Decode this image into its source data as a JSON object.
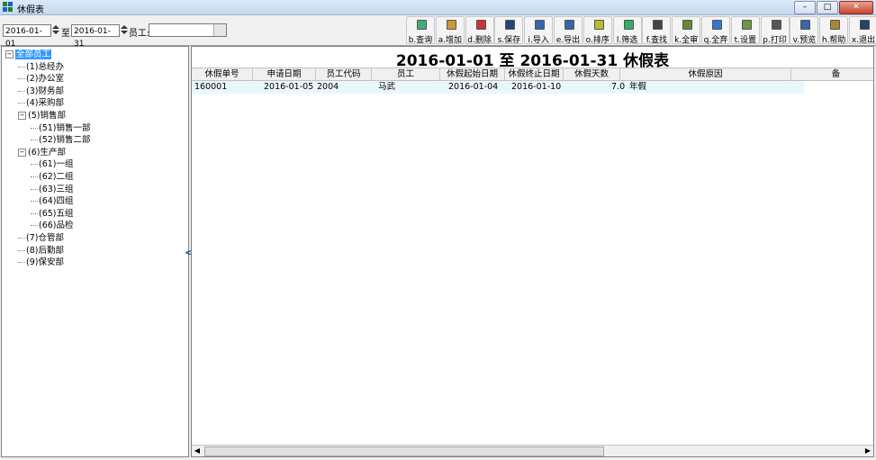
{
  "window": {
    "title": "休假表",
    "min": "–",
    "max": "□",
    "close": "✕"
  },
  "filter": {
    "date_from": "2016-01-01",
    "to_label": "至",
    "date_to": "2016-01-31",
    "employee_label": "员工:",
    "employee_value": ""
  },
  "toolbar": [
    {
      "key": "b",
      "label": "b.查询",
      "icon": "query-icon"
    },
    {
      "key": "a",
      "label": "a.增加",
      "icon": "add-icon"
    },
    {
      "key": "d",
      "label": "d.删除",
      "icon": "delete-icon"
    },
    {
      "key": "s",
      "label": "s.保存",
      "icon": "save-icon"
    },
    {
      "key": "i",
      "label": "i.导入",
      "icon": "import-icon"
    },
    {
      "key": "e",
      "label": "e.导出",
      "icon": "export-icon"
    },
    {
      "key": "o",
      "label": "o.排序",
      "icon": "sort-icon"
    },
    {
      "key": "l",
      "label": "l.筛选",
      "icon": "filter-icon"
    },
    {
      "key": "f",
      "label": "f.查找",
      "icon": "find-icon"
    },
    {
      "key": "k",
      "label": "k.全审",
      "icon": "approve-all-icon"
    },
    {
      "key": "q",
      "label": "q.全弃",
      "icon": "discard-all-icon"
    },
    {
      "key": "t",
      "label": "t.设置",
      "icon": "settings-icon"
    },
    {
      "key": "p",
      "label": "p.打印",
      "icon": "print-icon"
    },
    {
      "key": "v",
      "label": "v.预览",
      "icon": "preview-icon"
    },
    {
      "key": "h",
      "label": "h.帮助",
      "icon": "help-icon"
    },
    {
      "key": "x",
      "label": "x.退出",
      "icon": "exit-icon"
    }
  ],
  "tree": [
    {
      "label": "全部员工",
      "level": 0,
      "box": "−",
      "selected": true
    },
    {
      "label": "(1)总经办",
      "level": 1
    },
    {
      "label": "(2)办公室",
      "level": 1
    },
    {
      "label": "(3)财务部",
      "level": 1
    },
    {
      "label": "(4)采购部",
      "level": 1
    },
    {
      "label": "(5)销售部",
      "level": 1,
      "box": "−"
    },
    {
      "label": "(51)销售一部",
      "level": 2
    },
    {
      "label": "(52)销售二部",
      "level": 2
    },
    {
      "label": "(6)生产部",
      "level": 1,
      "box": "−"
    },
    {
      "label": "(61)一组",
      "level": 2
    },
    {
      "label": "(62)二组",
      "level": 2
    },
    {
      "label": "(63)三组",
      "level": 2
    },
    {
      "label": "(64)四组",
      "level": 2
    },
    {
      "label": "(65)五组",
      "level": 2
    },
    {
      "label": "(66)品检",
      "level": 2
    },
    {
      "label": "(7)仓管部",
      "level": 1
    },
    {
      "label": "(8)后勤部",
      "level": 1
    },
    {
      "label": "(9)保安部",
      "level": 1
    }
  ],
  "collapse_glyph": "<<",
  "report": {
    "title": "2016-01-01 至 2016-01-31 休假表",
    "columns": [
      "休假单号",
      "申请日期",
      "员工代码",
      "员工",
      "休假起始日期",
      "休假终止日期",
      "休假天数",
      "休假原因",
      "备"
    ],
    "rows": [
      [
        "160001",
        "2016-01-05",
        "2004",
        "马武",
        "2016-01-04",
        "2016-01-10",
        "7.0",
        "年假",
        ""
      ]
    ]
  }
}
